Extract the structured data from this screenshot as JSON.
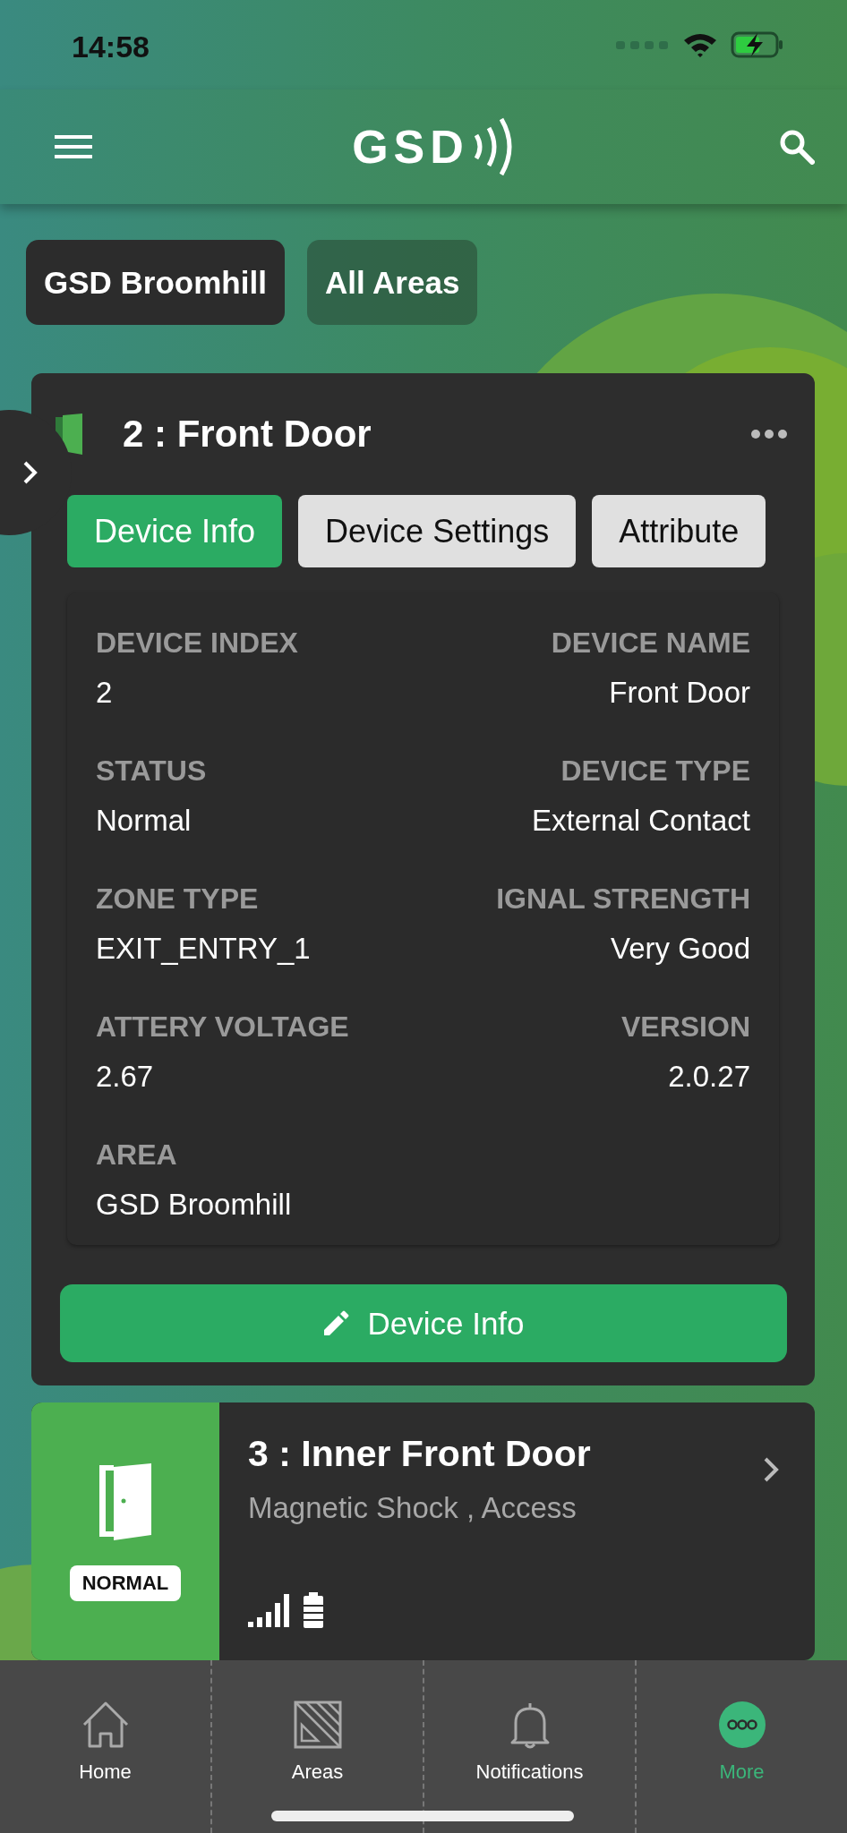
{
  "status_bar": {
    "time": "14:58"
  },
  "header": {
    "logo": "GSD"
  },
  "filters": [
    {
      "label": "GSD Broomhill",
      "selected": true
    },
    {
      "label": "All Areas",
      "selected": false
    }
  ],
  "device_card": {
    "title": "2 : Front Door",
    "tabs": [
      {
        "label": "Device Info",
        "selected": true
      },
      {
        "label": "Device Settings",
        "selected": false
      },
      {
        "label": "Attribute",
        "selected": false
      }
    ],
    "fields": [
      {
        "label": "DEVICE INDEX",
        "value": "2"
      },
      {
        "label": "DEVICE NAME",
        "value": "Front Door"
      },
      {
        "label": "STATUS",
        "value": "Normal"
      },
      {
        "label": "DEVICE TYPE",
        "value": "External Contact"
      },
      {
        "label": "ZONE TYPE",
        "value": "EXIT_ENTRY_1"
      },
      {
        "label": "IGNAL STRENGTH",
        "value": "Very Good"
      },
      {
        "label": "ATTERY VOLTAGE",
        "value": "2.67"
      },
      {
        "label": "VERSION",
        "value": "2.0.27"
      },
      {
        "label": "AREA",
        "value": "GSD Broomhill"
      }
    ],
    "action_button": "Device Info"
  },
  "devices": [
    {
      "title": "3 : Inner Front Door",
      "subtitle": "Magnetic Shock , Access",
      "status": "NORMAL"
    }
  ],
  "nav": [
    {
      "label": "Home",
      "kind": "home",
      "selected": false
    },
    {
      "label": "Areas",
      "kind": "areas",
      "selected": false
    },
    {
      "label": "Notifications",
      "kind": "bell",
      "selected": false
    },
    {
      "label": "More",
      "kind": "more",
      "selected": true
    }
  ]
}
